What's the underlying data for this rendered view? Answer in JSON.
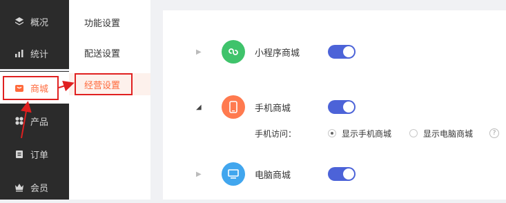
{
  "sidebar": {
    "items": [
      {
        "label": "概况",
        "icon": "layers-icon"
      },
      {
        "label": "统计",
        "icon": "chart-icon"
      },
      {
        "label": "商城",
        "icon": "shop-icon"
      },
      {
        "label": "产品",
        "icon": "grid-icon"
      },
      {
        "label": "订单",
        "icon": "clipboard-icon"
      },
      {
        "label": "会员",
        "icon": "crown-icon"
      }
    ]
  },
  "submenu": {
    "items": [
      {
        "label": "功能设置"
      },
      {
        "label": "配送设置"
      },
      {
        "label": "经营设置"
      }
    ]
  },
  "content": {
    "mini_program": {
      "label": "小程序商城",
      "enabled": true
    },
    "mobile": {
      "label": "手机商城",
      "enabled": true,
      "access_label": "手机访问：",
      "options": [
        "显示手机商城",
        "显示电脑商城"
      ],
      "selected": "显示手机商城",
      "help": "?"
    },
    "pc": {
      "label": "电脑商城",
      "enabled": true
    }
  },
  "colors": {
    "sidebar_bg": "#2b2b2b",
    "accent": "#ff6a3c",
    "switch_on": "#4c63d8",
    "mini_program_icon": "#3fc36b",
    "mobile_icon": "#ff7a4f",
    "pc_icon": "#41a6ee",
    "annotation": "#e02020"
  }
}
